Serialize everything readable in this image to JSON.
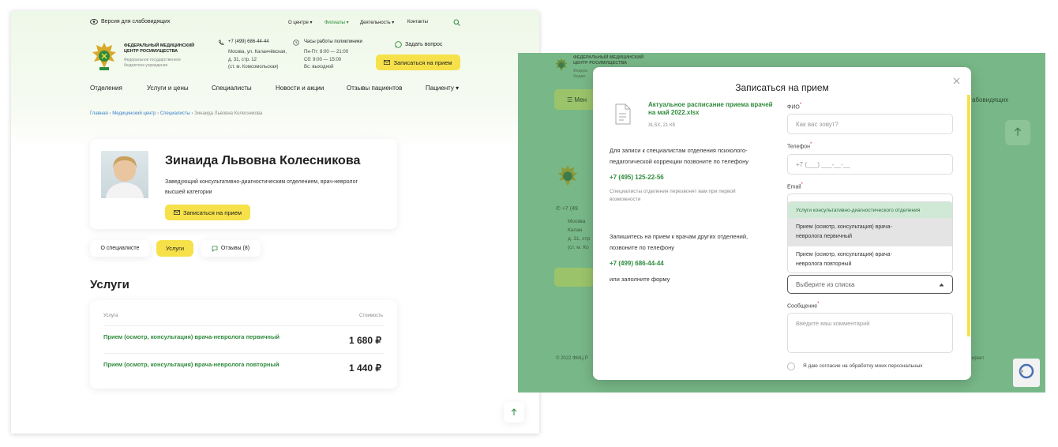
{
  "left": {
    "header": {
      "accessibility_label": "Версия для слабовидящих",
      "top_nav": [
        "О центре",
        "Филиалы",
        "Деятельность",
        "Контакты"
      ],
      "logo_title_line1": "ФЕДЕРАЛЬНЫЙ МЕДИЦИНСКИЙ",
      "logo_title_line2": "ЦЕНТР РОСИМУЩЕСТВА",
      "logo_sub_line1": "Федеральное государственное",
      "logo_sub_line2": "бюджетное учреждение",
      "phone": "+7 (499) 686-44-44",
      "address_line1": "Москва, ул. Каланчёвская,",
      "address_line2": "д. 31, стр. 12",
      "address_line3": "(ст. м. Комсомольская)",
      "hours_title": "Часы работы поликлиники",
      "hours_line1": "Пн-Пт: 8:00 — 21:00",
      "hours_line2": "Сб: 9:00 — 15:00",
      "hours_line3": "Вс: выходной",
      "ask_label": "Задать вопрос",
      "appointment_button": "Записаться на прием",
      "main_nav": [
        "Отделения",
        "Услуги и цены",
        "Специалисты",
        "Новости и акции",
        "Отзывы пациентов",
        "Пациенту"
      ]
    },
    "breadcrumb": [
      "Главная",
      "Медицинский центр",
      "Специалисты",
      "Зинаида Львовна Колесникова"
    ],
    "doctor": {
      "name": "Зинаида Львовна Колесникова",
      "position_line1": "Заведующий консультативно-диагностическим отделением, врач-невролог",
      "position_line2": "высшей категории",
      "button": "Записаться на прием"
    },
    "tabs": [
      "О специалисте",
      "Услуги",
      "Отзывы (8)"
    ],
    "services": {
      "heading": "Услуги",
      "col_service": "Услуга",
      "col_price": "Стоимость",
      "rows": [
        {
          "name": "Прием (осмотр, консультация) врача-невролога первичный",
          "price": "1 680 ₽"
        },
        {
          "name": "Прием (осмотр, консультация) врача-невролога повторный",
          "price": "1 440 ₽"
        }
      ]
    }
  },
  "right": {
    "bg_title_line1": "ФЕДЕРАЛЬНЫЙ МЕДИЦИНСКИЙ",
    "bg_title_line2": "ЦЕНТР РОСИМУЩЕСТВА",
    "bg_sub1": "Федера",
    "bg_sub2": "бюдже",
    "bg_menu": "Мен",
    "bg_right_text": "абовидящих",
    "bg_phone": "+7 (49",
    "bg_addr1": "Москва",
    "bg_addr2": "Калан",
    "bg_addr3": "д. 31, стр",
    "bg_addr4": "(ст. м. Ко",
    "bg_footer": "© 2022 ФМЦ Р",
    "bg_footer_right": "ирект",
    "modal": {
      "title": "Записаться на прием",
      "file_title_line1": "Актуальное расписание приема врачей",
      "file_title_line2": "на май 2022.xlsx",
      "file_meta": "XLSX, 21 Кб",
      "info1_line1": "Для записи к специалистам отделения психолого-",
      "info1_line2": "педагогической коррекции позвоните по телефону",
      "phone1": "+7 (495) 125-22-56",
      "info1_note_line1": "Специалисты отделения перезвонят вам при первой",
      "info1_note_line2": "возможности",
      "info2_line1": "Запишитесь на прием к врачам других отделений,",
      "info2_line2": "позвоните по телефону",
      "phone2": "+7 (499) 686-44-44",
      "info2_note": "или заполните форму",
      "fio_label": "ФИО",
      "fio_placeholder": "Как вас зовут?",
      "phone_label": "Телефон",
      "phone_placeholder": "+7 (___) ___-__-__",
      "email_label": "Email",
      "dropdown_group": "Услуги консультативно-диагностического отделения",
      "dropdown_options": [
        {
          "line1": "Прием (осмотр, консультация) врача-",
          "line2": "невролога первичный"
        },
        {
          "line1": "Прием (осмотр, консультация) врача-",
          "line2": "невролога повторный"
        }
      ],
      "select_placeholder": "Выберите из списка",
      "message_label": "Сообщение",
      "message_placeholder": "Введите ваш комментарий",
      "consent": "Я даю согласие на обработку моих персональных"
    }
  },
  "colors": {
    "accent_green": "#2e8b3c",
    "yellow_button": "#f6e14a",
    "overlay_green": "#78b888",
    "dropdown_group_bg": "#cfe9d6",
    "dropdown_hover_bg": "#e4e4e4"
  }
}
